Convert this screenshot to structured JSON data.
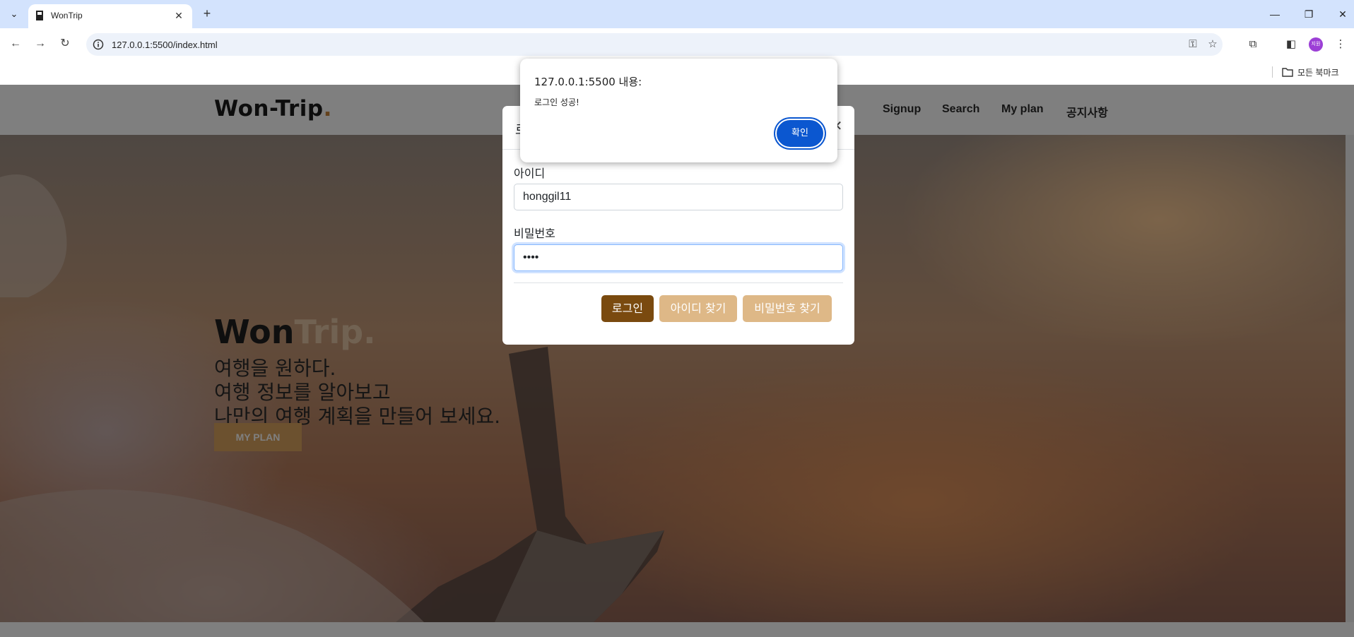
{
  "browser": {
    "tab_title": "WonTrip",
    "url": "127.0.0.1:5500/index.html",
    "profile_initials": "지원",
    "bookmarks_label": "모든 북마크"
  },
  "site": {
    "logo_main": "Won-Trip",
    "logo_dot": ".",
    "nav": [
      "Signup",
      "Search",
      "My plan",
      "공지사항"
    ]
  },
  "hero": {
    "title_dark": "Won",
    "title_light": "Trip",
    "title_dot": ".",
    "lines": [
      "여행을 원하다.",
      "여행 정보를 알아보고",
      "나만의 여행 계획을 만들어 보세요."
    ],
    "button": "MY PLAN"
  },
  "login_modal": {
    "title_partial": "로",
    "id_label": "아이디",
    "id_value": "honggil11",
    "pw_label": "비밀번호",
    "pw_value": "1234",
    "buttons": {
      "login": "로그인",
      "find_id": "아이디 찾기",
      "find_pw": "비밀번호 찾기"
    },
    "colors": {
      "login": "#7a4a0f",
      "secondary": "#deb887"
    }
  },
  "alert": {
    "origin": "127.0.0.1:5500 내용:",
    "message": "로그인 성공!",
    "ok": "확인"
  }
}
